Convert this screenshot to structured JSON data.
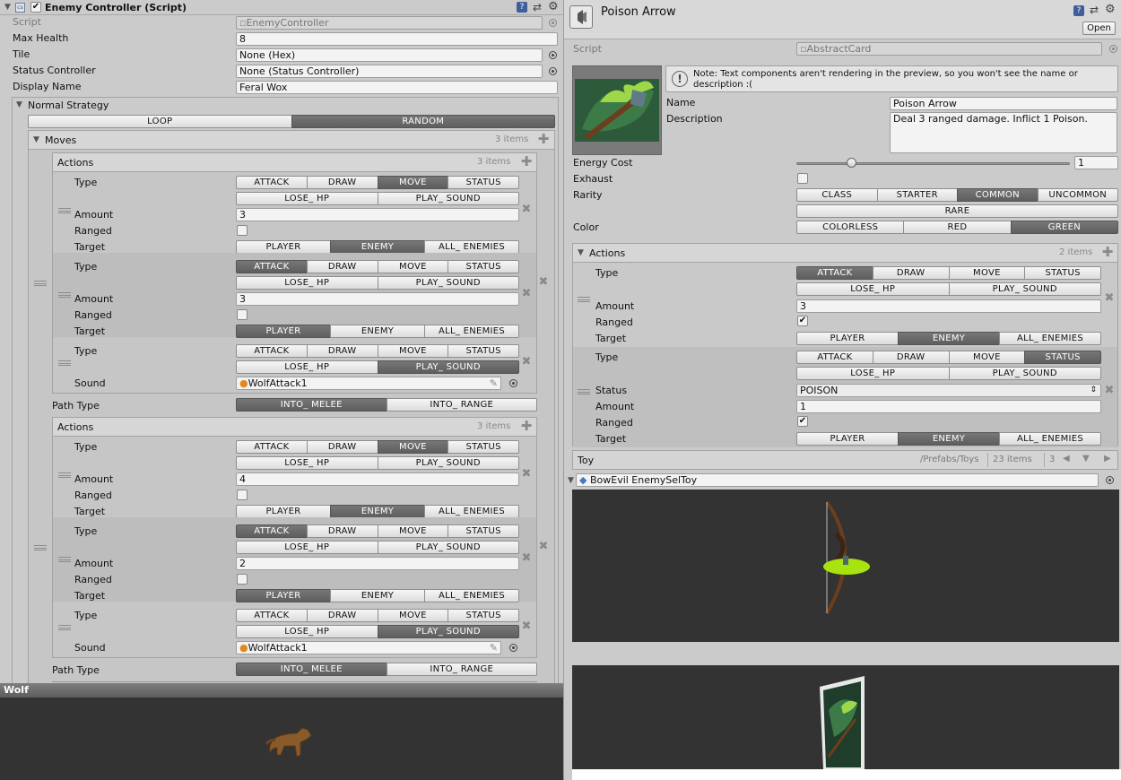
{
  "left": {
    "header": {
      "title": "Enemy Controller (Script)",
      "enabled": true
    },
    "script": {
      "label": "Script",
      "value": "EnemyController"
    },
    "max_health": {
      "label": "Max Health",
      "value": "8"
    },
    "tile": {
      "label": "Tile",
      "value": "None (Hex)"
    },
    "status_controller": {
      "label": "Status Controller",
      "value": "None (Status Controller)"
    },
    "display_name": {
      "label": "Display Name",
      "value": "Feral Wox"
    },
    "normal_strategy": {
      "label": "Normal Strategy",
      "options": [
        "LOOP",
        "RANDOM"
      ],
      "selected": "RANDOM"
    },
    "moves": {
      "label": "Moves",
      "count": "3 items"
    },
    "labels": {
      "actions": "Actions",
      "type": "Type",
      "amount": "Amount",
      "ranged": "Ranged",
      "target": "Target",
      "sound": "Sound",
      "path_type": "Path Type"
    },
    "type_opts_1": [
      "ATTACK",
      "DRAW",
      "MOVE",
      "STATUS"
    ],
    "type_opts_2": [
      "LOSE_ HP",
      "PLAY_ SOUND"
    ],
    "target_opts": [
      "PLAYER",
      "ENEMY",
      "ALL_ ENEMIES"
    ],
    "path_opts": [
      "INTO_ MELEE",
      "INTO_ RANGE"
    ],
    "move_groups": [
      {
        "count": "3 items",
        "actions": [
          {
            "type": "MOVE",
            "amount": "3",
            "ranged": false,
            "target": "ENEMY"
          },
          {
            "type": "ATTACK",
            "amount": "3",
            "ranged": false,
            "target": "PLAYER"
          },
          {
            "type": "PLAY_ SOUND",
            "sound": "WolfAttack1"
          }
        ],
        "path_type": "INTO_ MELEE"
      },
      {
        "count": "3 items",
        "actions": [
          {
            "type": "MOVE",
            "amount": "4",
            "ranged": false,
            "target": "ENEMY"
          },
          {
            "type": "ATTACK",
            "amount": "2",
            "ranged": false,
            "target": "PLAYER"
          },
          {
            "type": "PLAY_ SOUND",
            "sound": "WolfAttack1"
          }
        ],
        "path_type": "INTO_ MELEE"
      }
    ],
    "preview_title": "Wolf"
  },
  "right": {
    "title": "Poison Arrow",
    "open_button": "Open",
    "script": {
      "label": "Script",
      "value": "AbstractCard"
    },
    "note": "Note: Text components aren't rendering in the preview, so you won't see the name or description :(",
    "name": {
      "label": "Name",
      "value": "Poison Arrow"
    },
    "description": {
      "label": "Description",
      "value": "Deal 3 ranged damage. Inflict 1 Poison."
    },
    "energy_cost": {
      "label": "Energy Cost",
      "value": "1",
      "fraction": 0.2
    },
    "exhaust": {
      "label": "Exhaust",
      "checked": false
    },
    "rarity": {
      "label": "Rarity",
      "options_1": [
        "CLASS",
        "STARTER",
        "COMMON",
        "UNCOMMON"
      ],
      "options_2": [
        "RARE"
      ],
      "selected": "COMMON"
    },
    "color": {
      "label": "Color",
      "options": [
        "COLORLESS",
        "RED",
        "GREEN"
      ],
      "selected": "GREEN"
    },
    "actions": {
      "label": "Actions",
      "count": "2 items",
      "items": [
        {
          "type": "ATTACK",
          "amount": "3",
          "ranged": true,
          "target": "ENEMY"
        },
        {
          "type": "STATUS",
          "status": "POISON",
          "amount": "1",
          "ranged": true,
          "target": "ENEMY"
        }
      ],
      "status_label": "Status"
    },
    "toy": {
      "label": "Toy",
      "path": "/Prefabs/Toys",
      "count": "23 items",
      "index": "3"
    },
    "toy_object": "BowEvil EnemySelToy"
  },
  "colors": {
    "selected": "#666666",
    "preview_bg": "#333333",
    "disc": "#a8e20f"
  }
}
